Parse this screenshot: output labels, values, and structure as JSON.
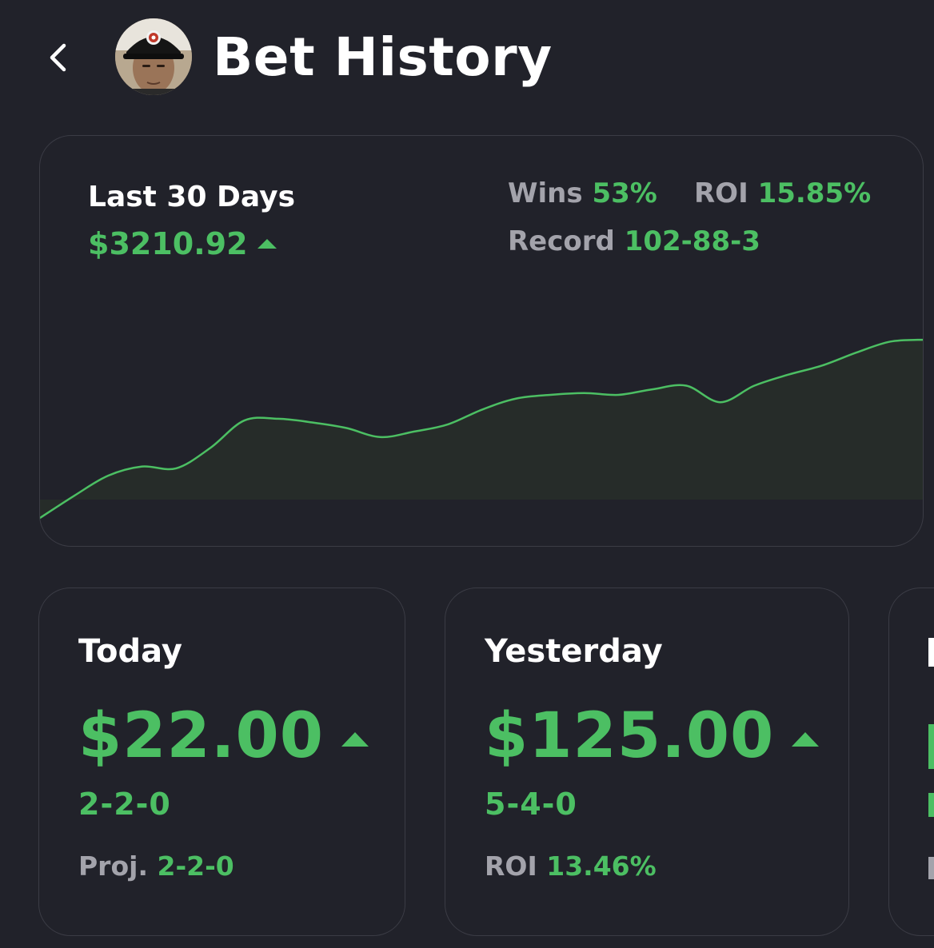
{
  "header": {
    "back_icon": "chevron-left-icon",
    "title": "Bet History"
  },
  "summary": {
    "period_label": "Last 30 Days",
    "total": "$3210.92",
    "trend": "up",
    "wins_label": "Wins",
    "wins_value": "53%",
    "roi_label": "ROI",
    "roi_value": "15.85%",
    "record_label": "Record",
    "record_value": "102-88-3"
  },
  "chart_data": {
    "type": "area",
    "title": "",
    "xlabel": "",
    "ylabel": "",
    "grid": false,
    "color": "#4cbf63",
    "values": [
      0,
      120,
      230,
      280,
      270,
      380,
      530,
      540,
      520,
      490,
      440,
      470,
      510,
      590,
      650,
      670,
      680,
      670,
      700,
      720,
      630,
      720,
      780,
      830,
      900,
      960,
      970
    ]
  },
  "cards": [
    {
      "title": "Today",
      "amount": "$22.00",
      "trend": "up",
      "record": "2-2-0",
      "extra_label": "Proj.",
      "extra_value": "2-2-0"
    },
    {
      "title": "Yesterday",
      "amount": "$125.00",
      "trend": "up",
      "record": "5-4-0",
      "extra_label": "ROI",
      "extra_value": "13.46%"
    }
  ],
  "colors": {
    "background": "#21222a",
    "accent_green": "#4cbf63",
    "muted_text": "#a3a3ab",
    "card_border": "#3b3c45"
  }
}
